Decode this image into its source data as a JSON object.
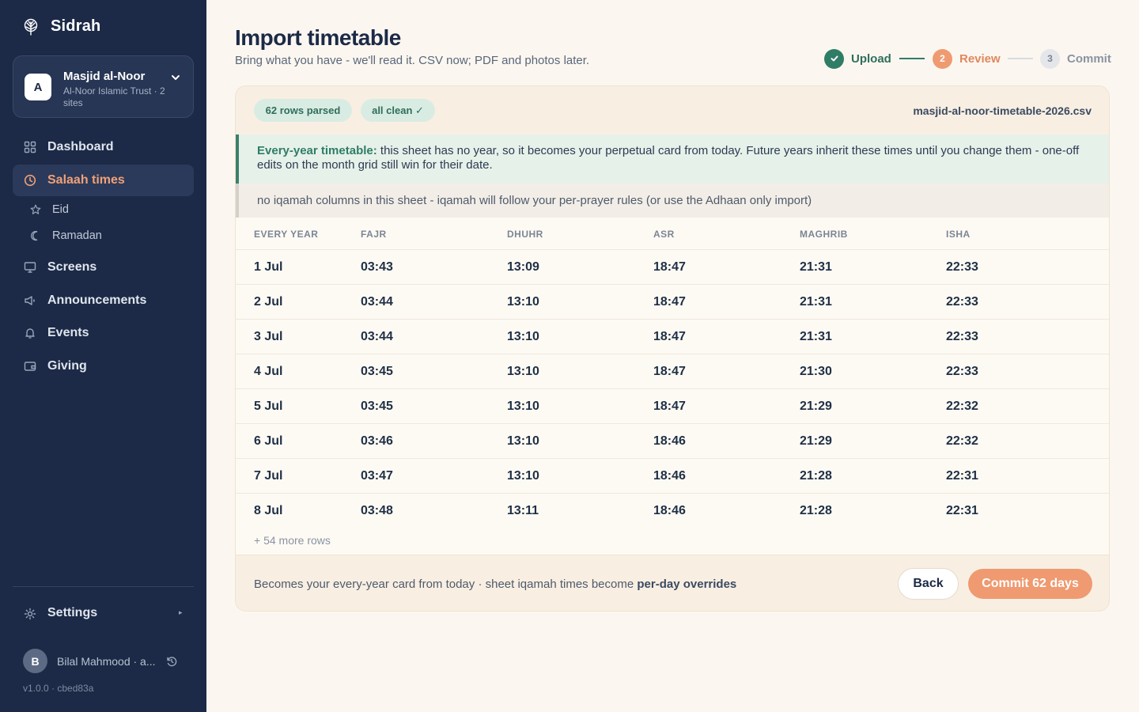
{
  "app": {
    "brand": "Sidrah",
    "version": "v1.0.0 · cbed83a"
  },
  "org": {
    "avatar": "A",
    "name": "Masjid al-Noor",
    "subtitle": "Al-Noor Islamic Trust · 2 sites"
  },
  "nav": {
    "dashboard": "Dashboard",
    "salaah": "Salaah times",
    "eid": "Eid",
    "ramadan": "Ramadan",
    "screens": "Screens",
    "announcements": "Announcements",
    "events": "Events",
    "giving": "Giving",
    "settings": "Settings"
  },
  "user": {
    "avatar": "B",
    "name": "Bilal Mahmood · a..."
  },
  "page": {
    "title": "Import timetable",
    "subtitle": "Bring what you have - we'll read it. CSV now; PDF and photos later."
  },
  "stepper": {
    "steps": [
      {
        "num": "✓",
        "label": "Upload",
        "state": "done"
      },
      {
        "num": "2",
        "label": "Review",
        "state": "current"
      },
      {
        "num": "3",
        "label": "Commit",
        "state": "todo"
      }
    ]
  },
  "summary": {
    "rows_parsed": "62 rows parsed",
    "status": "all clean ✓",
    "filename": "masjid-al-noor-timetable-2026.csv"
  },
  "notices": {
    "every_year_title": "Every-year timetable:",
    "every_year_body": " this sheet has no year, so it becomes your perpetual card from today. Future years inherit these times until you change them - one-off edits on the month grid still win for their date.",
    "iqamah_note": "no iqamah columns in this sheet - iqamah will follow your per-prayer rules (or use the Adhaan only import)"
  },
  "table": {
    "headers": [
      "EVERY YEAR",
      "FAJR",
      "DHUHR",
      "ASR",
      "MAGHRIB",
      "ISHA"
    ],
    "rows": [
      [
        "1 Jul",
        "03:43",
        "13:09",
        "18:47",
        "21:31",
        "22:33"
      ],
      [
        "2 Jul",
        "03:44",
        "13:10",
        "18:47",
        "21:31",
        "22:33"
      ],
      [
        "3 Jul",
        "03:44",
        "13:10",
        "18:47",
        "21:31",
        "22:33"
      ],
      [
        "4 Jul",
        "03:45",
        "13:10",
        "18:47",
        "21:30",
        "22:33"
      ],
      [
        "5 Jul",
        "03:45",
        "13:10",
        "18:47",
        "21:29",
        "22:32"
      ],
      [
        "6 Jul",
        "03:46",
        "13:10",
        "18:46",
        "21:29",
        "22:32"
      ],
      [
        "7 Jul",
        "03:47",
        "13:10",
        "18:46",
        "21:28",
        "22:31"
      ],
      [
        "8 Jul",
        "03:48",
        "13:11",
        "18:46",
        "21:28",
        "22:31"
      ]
    ],
    "more_rows": "+ 54 more rows"
  },
  "footer": {
    "text": "Becomes your every-year card from today · sheet iqamah times become ",
    "strong": "per-day overrides",
    "back_label": "Back",
    "commit_label": "Commit 62 days"
  },
  "colors": {
    "sidebar_bg": "#1c2a47",
    "accent": "#ef9a70",
    "success": "#2f7d66",
    "page_bg": "#fbf7f0"
  },
  "icons": {
    "brand": "tree-logo-icon",
    "org_chevron": "chevron-down-icon",
    "dashboard": "grid-icon",
    "salaah": "clock-icon",
    "eid": "star-icon",
    "ramadan": "crescent-moon-icon",
    "screens": "monitor-icon",
    "announcements": "megaphone-icon",
    "events": "bell-icon",
    "giving": "wallet-icon",
    "settings": "gear-icon",
    "user_refresh": "refresh-icon"
  }
}
